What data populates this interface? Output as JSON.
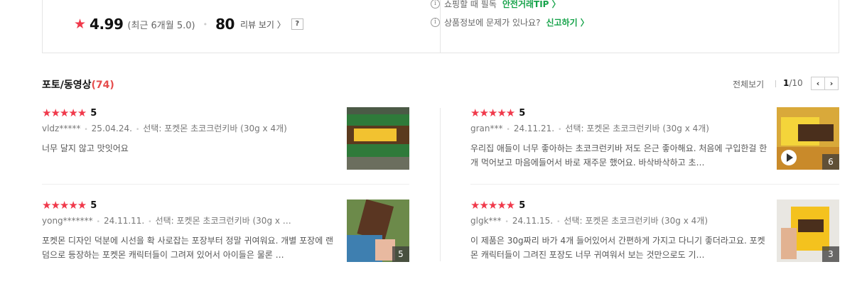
{
  "summary": {
    "score": "4.99",
    "recent": "(최근 6개월 5.0)",
    "review_count": "80",
    "review_link": "리뷰 보기 〉",
    "help": "?"
  },
  "notices": [
    {
      "text": "쇼핑할 때 필독",
      "link": "안전거래TIP 〉"
    },
    {
      "text": "상품정보에 문제가 있나요?",
      "link": "신고하기 〉"
    }
  ],
  "section": {
    "title": "포토/동영상",
    "count": "(74)",
    "view_all": "전체보기",
    "page_current": "1",
    "page_total": "/10",
    "prev": "‹",
    "next": "›"
  },
  "reviews": [
    {
      "stars": "★★★★★",
      "score": "5",
      "user": "vldz*****",
      "date": "25.04.24.",
      "option": "선택: 포켓몬 초코크런키바 (30g x 4개)",
      "text": "너무 달지 않고 맛잇어요",
      "photo_count": "",
      "icon": "photo-thumbnail"
    },
    {
      "stars": "★★★★★",
      "score": "5",
      "user": "gran***",
      "date": "24.11.21.",
      "option": "선택: 포켓몬 초코크런키바 (30g x 4개)",
      "text": "우리집 애들이 너무 좋아하는 초코크런키바 저도 은근 좋아해요. 처음에 구입한걸 한개 먹어보고 마음에들어서 바로 재주문 했어요. 바삭바삭하고 초…",
      "photo_count": "6",
      "icon": "video-thumbnail"
    },
    {
      "stars": "★★★★★",
      "score": "5",
      "user": "yong*******",
      "date": "24.11.11.",
      "option": "선택: 포켓몬 초코크런키바 (30g x …",
      "text": "포켓몬 디자인 덕분에 시선을 확 사로잡는 포장부터 정말 귀여워요. 개별 포장에 랜덤으로 등장하는 포켓몬 캐릭터들이 그려져 있어서 아이들은 물론 …",
      "photo_count": "5",
      "icon": "photo-thumbnail"
    },
    {
      "stars": "★★★★★",
      "score": "5",
      "user": "glgk***",
      "date": "24.11.15.",
      "option": "선택: 포켓몬 초코크런키바 (30g x 4개)",
      "text": "이 제품은 30g짜리 바가 4개 들어있어서 간편하게 가지고 다니기 좋더라고요. 포켓몬 캐릭터들이 그려진 포장도 너무 귀여워서 보는 것만으로도 기…",
      "photo_count": "3",
      "icon": "photo-thumbnail"
    }
  ]
}
